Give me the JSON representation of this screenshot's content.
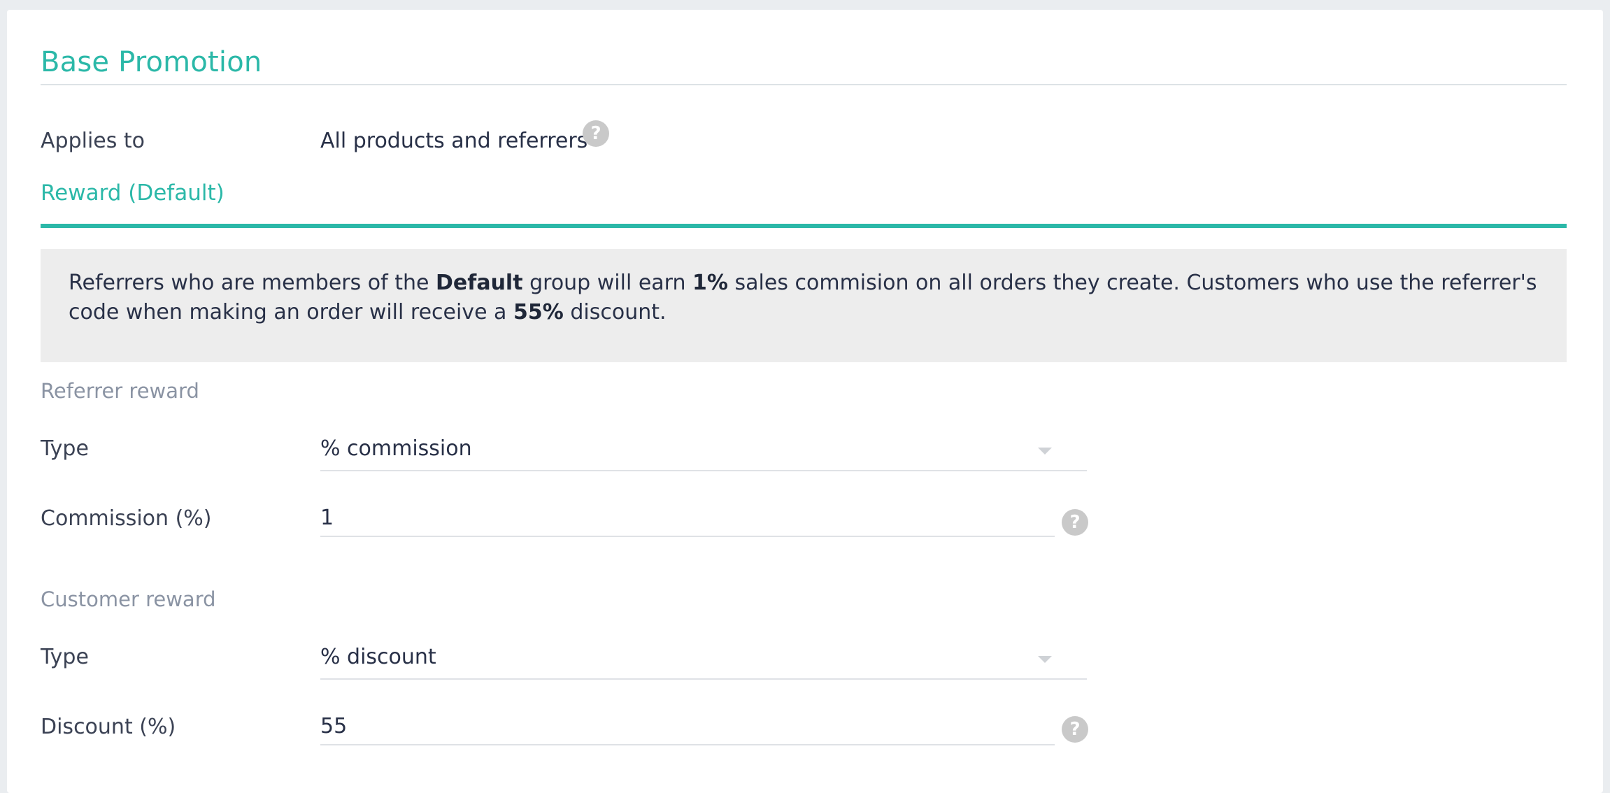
{
  "section": {
    "title": "Base Promotion"
  },
  "applies_to": {
    "label": "Applies to",
    "value": "All products and referrers"
  },
  "tab": {
    "label": "Reward (Default)"
  },
  "info": {
    "part1": "Referrers who are members of the ",
    "group": "Default",
    "part2": " group will earn ",
    "commission": "1%",
    "part3": " sales commision on all orders they create. Customers who use the referrer's code when making an order will receive a ",
    "discount": "55%",
    "part4": " discount."
  },
  "referrer_reward": {
    "heading": "Referrer reward",
    "type_label": "Type",
    "type_value": "% commission",
    "commission_label": "Commission (%)",
    "commission_value": "1"
  },
  "customer_reward": {
    "heading": "Customer reward",
    "type_label": "Type",
    "type_value": "% discount",
    "discount_label": "Discount (%)",
    "discount_value": "55"
  },
  "icons": {
    "help": "?"
  },
  "colors": {
    "accent": "#2bb8a8",
    "help_icon": "#c9c9c9",
    "info_bg": "#ededed"
  }
}
